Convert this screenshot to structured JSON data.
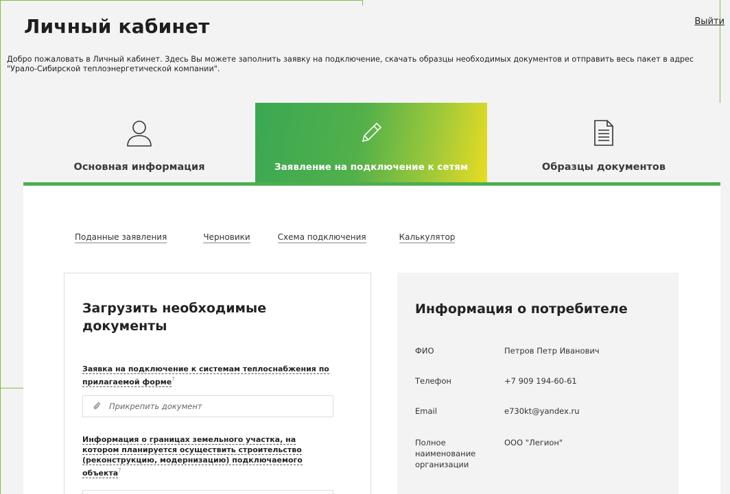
{
  "header": {
    "title": "Личный кабинет",
    "logout_label": "Выйти"
  },
  "welcome_text": "Добро пожаловать в Личный кабинет. Здесь Вы можете заполнить заявку на подключение, скачать образцы необходимых документов и отправить весь пакет в адрес \"Урало-Сибирской теплоэнергетической компании\".",
  "tabs": [
    {
      "label": "Основная информация",
      "icon": "user-icon",
      "active": false
    },
    {
      "label": "Заявление на подключение к сетям",
      "icon": "pencil-icon",
      "active": true
    },
    {
      "label": "Образцы документов",
      "icon": "document-icon",
      "active": false
    }
  ],
  "subnav": [
    "Поданные заявления",
    "Черновики",
    "Схема подключения",
    "Калькулятор"
  ],
  "upload": {
    "title": "Загрузить необходимые документы",
    "fields": [
      {
        "label": "Заявка на подключение к системам теплоснабжения по прилагаемой форме",
        "help": "?",
        "attach_label": "Прикрепить документ"
      },
      {
        "label": "Информация о границах земельного участка, на котором планируется осуществить строительство (реконструкцию, модернизацию) подключаемого объекта",
        "help": "?",
        "attach_label": ""
      }
    ]
  },
  "consumer": {
    "title": "Информация о потребителе",
    "rows": [
      {
        "key": "ФИО",
        "value": "Петров Петр Иванович"
      },
      {
        "key": "Телефон",
        "value": "+7 909 194-60-61"
      },
      {
        "key": "Email",
        "value": "e730kt@yandex.ru"
      },
      {
        "key": "Полное наименование организации",
        "value": "ООО \"Легион\""
      }
    ]
  },
  "colors": {
    "accent_green": "#4caf50",
    "gradient_start": "#3aa853",
    "gradient_end": "#e8dc22",
    "frame_green": "#7cc142"
  }
}
